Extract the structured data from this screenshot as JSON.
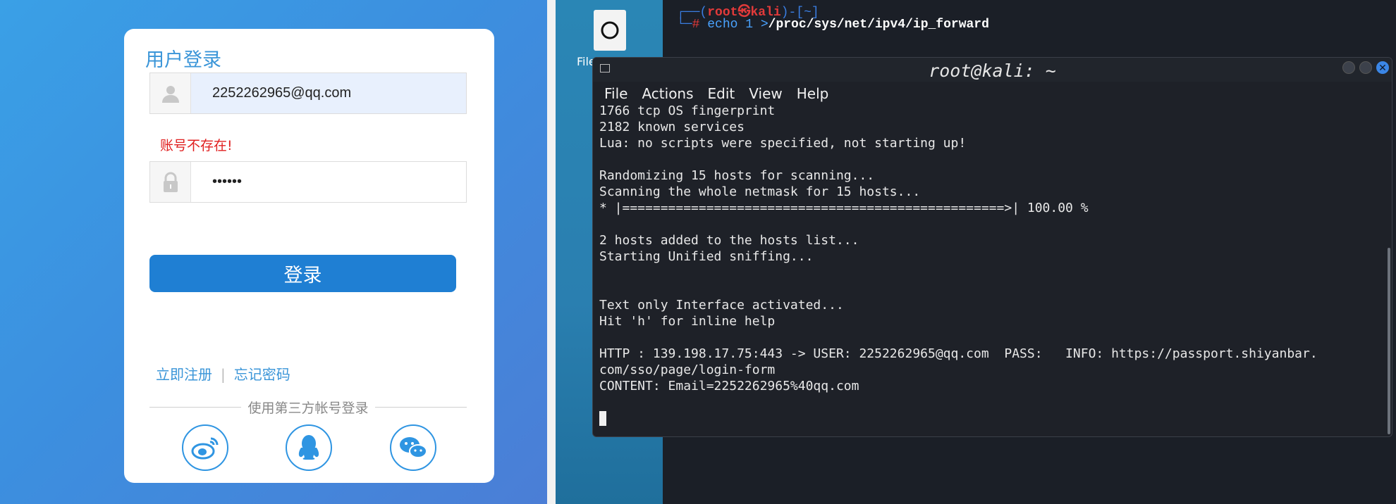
{
  "login": {
    "title": "用户登录",
    "email_value": "2252262965@qq.com",
    "error_text": "账号不存在!",
    "password_value": "••••••",
    "submit_label": "登录",
    "register_link": "立即注册",
    "separator": "|",
    "forgot_link": "忘记密码",
    "third_party_label": "使用第三方帐号登录",
    "social_icons": [
      "weibo-icon",
      "qq-icon",
      "wechat-icon"
    ],
    "colors": {
      "accent": "#1f7fd3",
      "error": "#e02020",
      "link": "#3a95d8"
    }
  },
  "desktop": {
    "file_icon_label": "File System"
  },
  "background_terminal": {
    "prompt_user": "root",
    "prompt_host": "kali",
    "prompt_dir": "~",
    "command": "echo 1 >",
    "command_path": "/proc/sys/net/ipv4/ip_forward"
  },
  "terminal": {
    "title": "root@kali: ~",
    "menu": [
      "File",
      "Actions",
      "Edit",
      "View",
      "Help"
    ],
    "lines": [
      "1766 tcp OS fingerprint",
      "2182 known services",
      "Lua: no scripts were specified, not starting up!",
      "",
      "Randomizing 15 hosts for scanning...",
      "Scanning the whole netmask for 15 hosts...",
      "* |==================================================>| 100.00 %",
      "",
      "2 hosts added to the hosts list...",
      "Starting Unified sniffing...",
      "",
      "",
      "Text only Interface activated...",
      "Hit 'h' for inline help",
      "",
      "HTTP : 139.198.17.75:443 -> USER: 2252262965@qq.com  PASS:   INFO: https://passport.shiyanbar.",
      "com/sso/page/login-form",
      "CONTENT: Email=2252262965%40qq.com"
    ]
  }
}
